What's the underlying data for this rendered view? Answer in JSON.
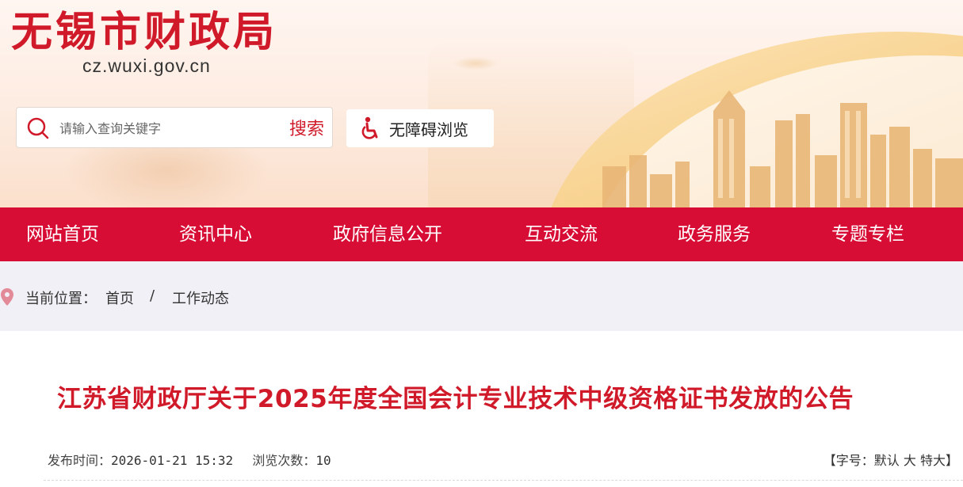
{
  "site": {
    "title": "无锡市财政局",
    "domain": "cz.wuxi.gov.cn"
  },
  "search": {
    "placeholder": "请输入查询关键字",
    "button_label": "搜索"
  },
  "accessibility": {
    "label": "无障碍浏览"
  },
  "nav": {
    "items": [
      {
        "label": "网站首页"
      },
      {
        "label": "资讯中心"
      },
      {
        "label": "政府信息公开"
      },
      {
        "label": "互动交流"
      },
      {
        "label": "政务服务"
      },
      {
        "label": "专题专栏"
      }
    ]
  },
  "breadcrumb": {
    "prefix": "当前位置：",
    "home": "首页",
    "separator": "/",
    "current": "工作动态"
  },
  "article": {
    "title": "江苏省财政厅关于2025年度全国会计专业技术中级资格证书发放的公告",
    "publish_label": "发布时间：",
    "publish_time": "2026-01-21 15:32",
    "views_label": "浏览次数：",
    "views": "10",
    "font_size_label": "【字号：",
    "font_default": "默认",
    "font_large": "大",
    "font_xlarge": "特大",
    "font_close": "】"
  },
  "colors": {
    "brand_red": "#d01a2a",
    "nav_red": "#d80d35",
    "breadcrumb_bg": "#f1f0f6"
  },
  "icons": {
    "search": "search-icon",
    "accessibility": "wheelchair-icon",
    "location": "location-pin-icon"
  }
}
